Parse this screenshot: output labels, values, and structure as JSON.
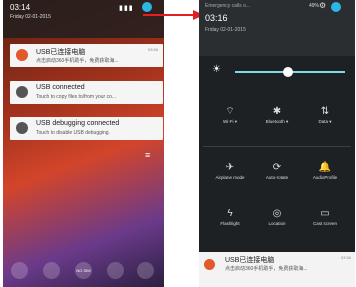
{
  "left": {
    "time": "03:14",
    "date": "Friday 02-01-2015",
    "status_icons": "▮▮▮",
    "notifications": [
      {
        "title": "USB已连接电脑",
        "subtitle": "点击启动360手机助手，免费获取海...",
        "time": "03:56",
        "icon": "360-icon"
      },
      {
        "title": "USB connected",
        "subtitle": "Touch to copy files to/from your co...",
        "time": "",
        "icon": "usb-icon"
      },
      {
        "title": "USB debugging connected",
        "subtitle": "Touch to disable USB debugging.",
        "time": "",
        "icon": "android-debug-icon"
      }
    ],
    "dock_label": "NO SIM"
  },
  "right": {
    "carrier": "Emergency calls o...",
    "battery": "49%",
    "time": "03:16",
    "date": "Friday 02-01-2015",
    "tiles_row1": [
      {
        "label": "Wi-Fi ▾",
        "glyph": "⌔"
      },
      {
        "label": "Bluetooth ▾",
        "glyph": "✱"
      },
      {
        "label": "Data ▾",
        "glyph": "⇅"
      }
    ],
    "tiles_row2": [
      {
        "label": "Airplane mode",
        "glyph": "✈"
      },
      {
        "label": "Auto-rotate",
        "glyph": "⟳"
      },
      {
        "label": "AudioProfile",
        "glyph": "🔔"
      }
    ],
    "tiles_row3": [
      {
        "label": "Flashlight",
        "glyph": "ϟ"
      },
      {
        "label": "Location",
        "glyph": "◎"
      },
      {
        "label": "Cast screen",
        "glyph": "▭"
      }
    ],
    "notification": {
      "title": "USB已连接电脑",
      "subtitle": "点击启动360手机助手，免费获取海...",
      "time": "03:56"
    }
  },
  "colors": {
    "accent": "#2bb6e6",
    "arrow": "#e02020"
  }
}
